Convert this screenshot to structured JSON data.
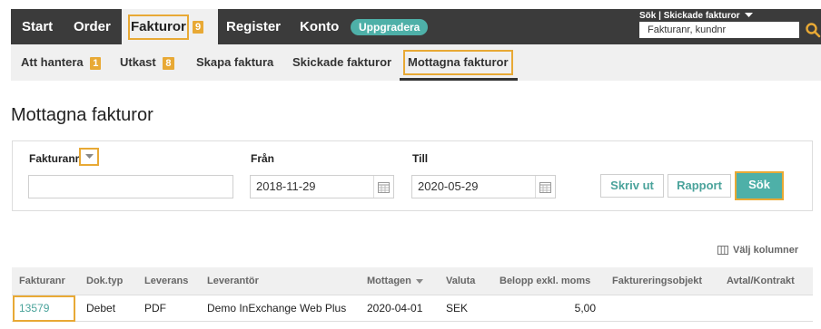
{
  "topnav": {
    "items": [
      {
        "label": "Start"
      },
      {
        "label": "Order"
      },
      {
        "label": "Fakturor",
        "badge": "9"
      },
      {
        "label": "Register"
      },
      {
        "label": "Konto"
      }
    ],
    "upgrade_label": "Uppgradera",
    "search_scope": "Sök | Skickade fakturor",
    "search_value": "Fakturanr, kundnr"
  },
  "subnav": {
    "items": [
      {
        "label": "Att hantera",
        "badge": "1"
      },
      {
        "label": "Utkast",
        "badge": "8"
      },
      {
        "label": "Skapa faktura"
      },
      {
        "label": "Skickade fakturor"
      },
      {
        "label": "Mottagna fakturor"
      }
    ]
  },
  "page_title": "Mottagna fakturor",
  "filter": {
    "fakturanr_label": "Fakturanr",
    "fakturanr_value": "",
    "from_label": "Från",
    "from_value": "2018-11-29",
    "to_label": "Till",
    "to_value": "2020-05-29",
    "print_label": "Skriv ut",
    "report_label": "Rapport",
    "search_label": "Sök"
  },
  "choose_columns_label": "Välj kolumner",
  "table": {
    "headers": [
      "Fakturanr",
      "Dok.typ",
      "Leverans",
      "Leverantör",
      "Mottagen",
      "Valuta",
      "Belopp exkl. moms",
      "Faktureringsobjekt",
      "Avtal/Kontrakt"
    ],
    "rows": [
      [
        "13579",
        "Debet",
        "PDF",
        "Demo InExchange Web Plus",
        "2020-04-01",
        "SEK",
        "5,00",
        "",
        ""
      ]
    ]
  },
  "colors": {
    "nav_bg": "#3b3b3b",
    "accent_teal": "#4eb0a8",
    "highlight_orange": "#e8a935"
  }
}
